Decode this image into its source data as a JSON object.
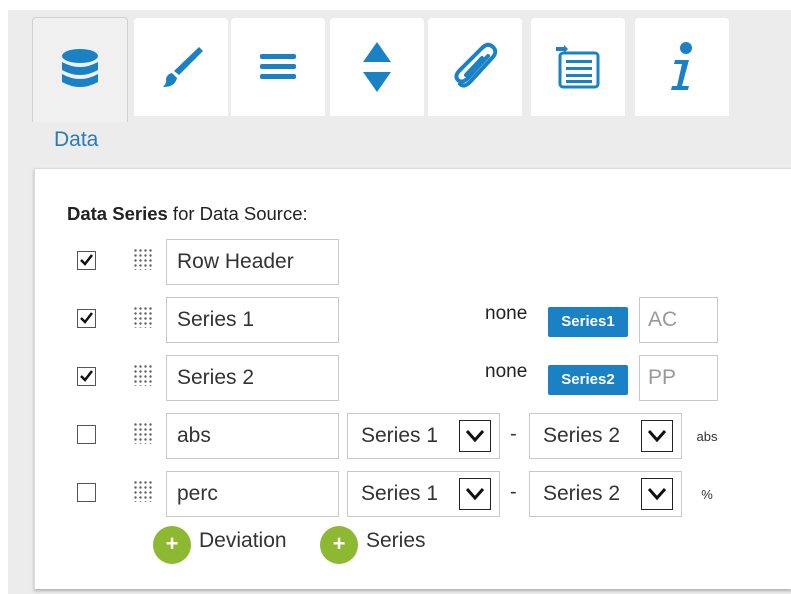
{
  "tabs": [
    {
      "icon": "database-icon",
      "active": true
    },
    {
      "icon": "paintbrush-icon",
      "active": false
    },
    {
      "icon": "menu-lines-icon",
      "active": false
    },
    {
      "icon": "sort-arrows-icon",
      "active": false
    },
    {
      "icon": "paperclip-icon",
      "active": false
    },
    {
      "icon": "list-icon",
      "active": false
    },
    {
      "icon": "info-icon",
      "active": false
    }
  ],
  "section_title": "Data",
  "panel": {
    "heading_bold": "Data Series",
    "heading_rest": " for Data Source:",
    "rows": [
      {
        "checked": true,
        "name": "Row Header"
      },
      {
        "checked": true,
        "name": "Series 1",
        "none_label": "none",
        "badge": "Series1",
        "code": "AC"
      },
      {
        "checked": true,
        "name": "Series 2",
        "none_label": "none",
        "badge": "Series2",
        "code": "PP"
      },
      {
        "checked": false,
        "name": "abs",
        "select_a": "Series 1",
        "dash": "-",
        "select_b": "Series 2",
        "suffix": "abs"
      },
      {
        "checked": false,
        "name": "perc",
        "select_a": "Series 1",
        "dash": "-",
        "select_b": "Series 2",
        "suffix": "%"
      }
    ],
    "add_deviation": {
      "symbol": "+",
      "label": "Deviation"
    },
    "add_series": {
      "symbol": "+",
      "label": "Series"
    }
  },
  "colors": {
    "accent": "#2b79b8",
    "badge": "#1a81c5",
    "add_button": "#8cb832",
    "icon": "#1a81c5"
  }
}
